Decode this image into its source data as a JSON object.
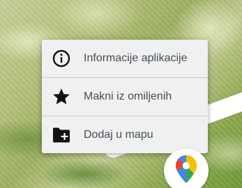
{
  "context_menu": {
    "items": [
      {
        "label": "Informacije aplikacije",
        "icon": "info-icon"
      },
      {
        "label": "Makni iz omiljenih",
        "icon": "star-icon"
      },
      {
        "label": "Dodaj u mapu",
        "icon": "folder-add-icon"
      }
    ]
  },
  "app": {
    "icon": "google-maps-icon"
  },
  "colors": {
    "menu_background": "#eef0f1",
    "menu_text": "#4a4d50",
    "icon_color": "#111111",
    "maps_red": "#ea4335",
    "maps_blue": "#4285f4",
    "maps_green": "#34a853",
    "maps_yellow": "#fbbc04"
  }
}
